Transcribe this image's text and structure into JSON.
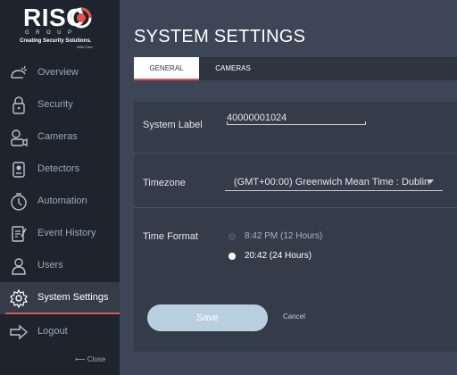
{
  "logo": {
    "brand": "RISC",
    "group": "GROUP",
    "tagline": "Creating Security Solutions.",
    "tagline_sub": "With Care."
  },
  "sidebar": {
    "items": [
      {
        "label": "Overview",
        "icon": "overview-icon",
        "active": false
      },
      {
        "label": "Security",
        "icon": "lock-icon",
        "active": false
      },
      {
        "label": "Cameras",
        "icon": "camera-icon",
        "active": false
      },
      {
        "label": "Detectors",
        "icon": "detector-icon",
        "active": false
      },
      {
        "label": "Automation",
        "icon": "automation-icon",
        "active": false
      },
      {
        "label": "Event History",
        "icon": "event-history-icon",
        "active": false
      },
      {
        "label": "Users",
        "icon": "user-icon",
        "active": false
      },
      {
        "label": "System Settings",
        "icon": "gear-icon",
        "active": true
      },
      {
        "label": "Logout",
        "icon": "logout-icon",
        "active": false
      }
    ],
    "close_label": "Close"
  },
  "header": {
    "title": "SYSTEM SETTINGS",
    "tabs": [
      {
        "label": "GENERAL",
        "active": true
      },
      {
        "label": "CAMERAS",
        "active": false
      }
    ]
  },
  "form": {
    "system_label": {
      "label": "System Label",
      "value": "40000001024"
    },
    "timezone": {
      "label": "Timezone",
      "value": "(GMT+00:00) Greenwich Mean Time : Dublin"
    },
    "time_format": {
      "label": "Time Format",
      "options": [
        {
          "label": "8:42 PM (12 Hours)",
          "selected": false
        },
        {
          "label": "20:42 (24 Hours)",
          "selected": true
        }
      ]
    },
    "save_label": "Save",
    "cancel_label": "Cancel"
  },
  "colors": {
    "accent": "#e8524a",
    "sidebar_bg": "#1e242d",
    "page_bg": "#3d4656",
    "panel_bg": "#343c49",
    "save_button": "#b9cfe0"
  }
}
